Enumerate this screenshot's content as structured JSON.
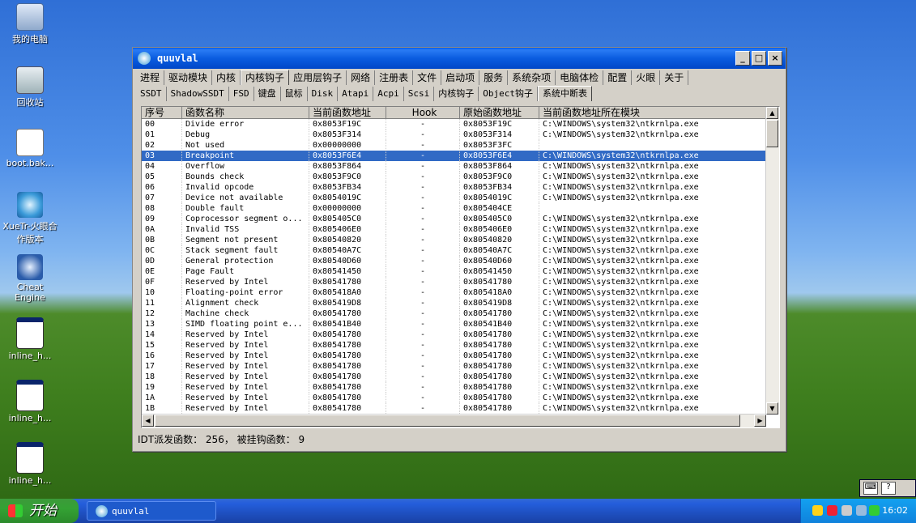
{
  "desktop": {
    "icons": [
      {
        "label": "我的电脑",
        "icon": "my-computer-icon"
      },
      {
        "label": "回收站",
        "icon": "recycle-bin-icon"
      },
      {
        "label": "boot.bak...",
        "icon": "document-icon"
      },
      {
        "label": "XueTr-火眼合作版本",
        "icon": "xuetr-icon"
      },
      {
        "label": "Cheat Engine",
        "icon": "cheat-engine-icon"
      },
      {
        "label": "inline_h...",
        "icon": "app-window-icon"
      },
      {
        "label": "inline_h...",
        "icon": "app-window-icon"
      },
      {
        "label": "inline_h...",
        "icon": "app-window-icon"
      }
    ]
  },
  "window": {
    "title": "quuvlal",
    "min": "_",
    "max": "□",
    "close": "×",
    "tabs_row1": [
      "进程",
      "驱动模块",
      "内核",
      "内核钩子",
      "应用层钩子",
      "网络",
      "注册表",
      "文件",
      "启动项",
      "服务",
      "系统杂项",
      "电脑体检",
      "配置",
      "火眼",
      "关于"
    ],
    "tabs_row1_active": 3,
    "tabs_row2": [
      "SSDT",
      "ShadowSSDT",
      "FSD",
      "键盘",
      "鼠标",
      "Disk",
      "Atapi",
      "Acpi",
      "Scsi",
      "内核钩子",
      "Object钩子",
      "系统中断表"
    ],
    "tabs_row2_active": 11,
    "columns": [
      "序号",
      "函数名称",
      "当前函数地址",
      "Hook",
      "原始函数地址",
      "当前函数地址所在模块"
    ],
    "rows": [
      [
        "00",
        "Divide error",
        "0x8053F19C",
        "-",
        "0x8053F19C",
        "C:\\WINDOWS\\system32\\ntkrnlpa.exe"
      ],
      [
        "01",
        "Debug",
        "0x8053F314",
        "-",
        "0x8053F314",
        "C:\\WINDOWS\\system32\\ntkrnlpa.exe"
      ],
      [
        "02",
        "Not used",
        "0x00000000",
        "-",
        "0x8053F3FC",
        ""
      ],
      [
        "03",
        "Breakpoint",
        "0x8053F6E4",
        "-",
        "0x8053F6E4",
        "C:\\WINDOWS\\system32\\ntkrnlpa.exe"
      ],
      [
        "04",
        "Overflow",
        "0x8053F864",
        "-",
        "0x8053F864",
        "C:\\WINDOWS\\system32\\ntkrnlpa.exe"
      ],
      [
        "05",
        "Bounds check",
        "0x8053F9C0",
        "-",
        "0x8053F9C0",
        "C:\\WINDOWS\\system32\\ntkrnlpa.exe"
      ],
      [
        "06",
        "Invalid opcode",
        "0x8053FB34",
        "-",
        "0x8053FB34",
        "C:\\WINDOWS\\system32\\ntkrnlpa.exe"
      ],
      [
        "07",
        "Device not available",
        "0x8054019C",
        "-",
        "0x8054019C",
        "C:\\WINDOWS\\system32\\ntkrnlpa.exe"
      ],
      [
        "08",
        "Double fault",
        "0x00000000",
        "-",
        "0x805404CE",
        ""
      ],
      [
        "09",
        "Coprocessor segment o...",
        "0x805405C0",
        "-",
        "0x805405C0",
        "C:\\WINDOWS\\system32\\ntkrnlpa.exe"
      ],
      [
        "0A",
        "Invalid TSS",
        "0x805406E0",
        "-",
        "0x805406E0",
        "C:\\WINDOWS\\system32\\ntkrnlpa.exe"
      ],
      [
        "0B",
        "Segment not present",
        "0x80540820",
        "-",
        "0x80540820",
        "C:\\WINDOWS\\system32\\ntkrnlpa.exe"
      ],
      [
        "0C",
        "Stack segment fault",
        "0x80540A7C",
        "-",
        "0x80540A7C",
        "C:\\WINDOWS\\system32\\ntkrnlpa.exe"
      ],
      [
        "0D",
        "General protection",
        "0x80540D60",
        "-",
        "0x80540D60",
        "C:\\WINDOWS\\system32\\ntkrnlpa.exe"
      ],
      [
        "0E",
        "Page Fault",
        "0x80541450",
        "-",
        "0x80541450",
        "C:\\WINDOWS\\system32\\ntkrnlpa.exe"
      ],
      [
        "0F",
        "Reserved by Intel",
        "0x80541780",
        "-",
        "0x80541780",
        "C:\\WINDOWS\\system32\\ntkrnlpa.exe"
      ],
      [
        "10",
        "Floating-point error",
        "0x805418A0",
        "-",
        "0x805418A0",
        "C:\\WINDOWS\\system32\\ntkrnlpa.exe"
      ],
      [
        "11",
        "Alignment check",
        "0x805419D8",
        "-",
        "0x805419D8",
        "C:\\WINDOWS\\system32\\ntkrnlpa.exe"
      ],
      [
        "12",
        "Machine check",
        "0x80541780",
        "-",
        "0x80541780",
        "C:\\WINDOWS\\system32\\ntkrnlpa.exe"
      ],
      [
        "13",
        "SIMD floating point e...",
        "0x80541B40",
        "-",
        "0x80541B40",
        "C:\\WINDOWS\\system32\\ntkrnlpa.exe"
      ],
      [
        "14",
        "Reserved by Intel",
        "0x80541780",
        "-",
        "0x80541780",
        "C:\\WINDOWS\\system32\\ntkrnlpa.exe"
      ],
      [
        "15",
        "Reserved by Intel",
        "0x80541780",
        "-",
        "0x80541780",
        "C:\\WINDOWS\\system32\\ntkrnlpa.exe"
      ],
      [
        "16",
        "Reserved by Intel",
        "0x80541780",
        "-",
        "0x80541780",
        "C:\\WINDOWS\\system32\\ntkrnlpa.exe"
      ],
      [
        "17",
        "Reserved by Intel",
        "0x80541780",
        "-",
        "0x80541780",
        "C:\\WINDOWS\\system32\\ntkrnlpa.exe"
      ],
      [
        "18",
        "Reserved by Intel",
        "0x80541780",
        "-",
        "0x80541780",
        "C:\\WINDOWS\\system32\\ntkrnlpa.exe"
      ],
      [
        "19",
        "Reserved by Intel",
        "0x80541780",
        "-",
        "0x80541780",
        "C:\\WINDOWS\\system32\\ntkrnlpa.exe"
      ],
      [
        "1A",
        "Reserved by Intel",
        "0x80541780",
        "-",
        "0x80541780",
        "C:\\WINDOWS\\system32\\ntkrnlpa.exe"
      ],
      [
        "1B",
        "Reserved by Intel",
        "0x80541780",
        "-",
        "0x80541780",
        "C:\\WINDOWS\\system32\\ntkrnlpa.exe"
      ]
    ],
    "selected_row": 3,
    "status": "IDT派发函数： 256， 被挂钩函数： 9"
  },
  "taskbar": {
    "start_label": "开始",
    "task_label": "quuvlal",
    "clock": "16:02"
  },
  "colors": {
    "selection": "#316ac5",
    "titlebar": "#0a5ce0"
  }
}
